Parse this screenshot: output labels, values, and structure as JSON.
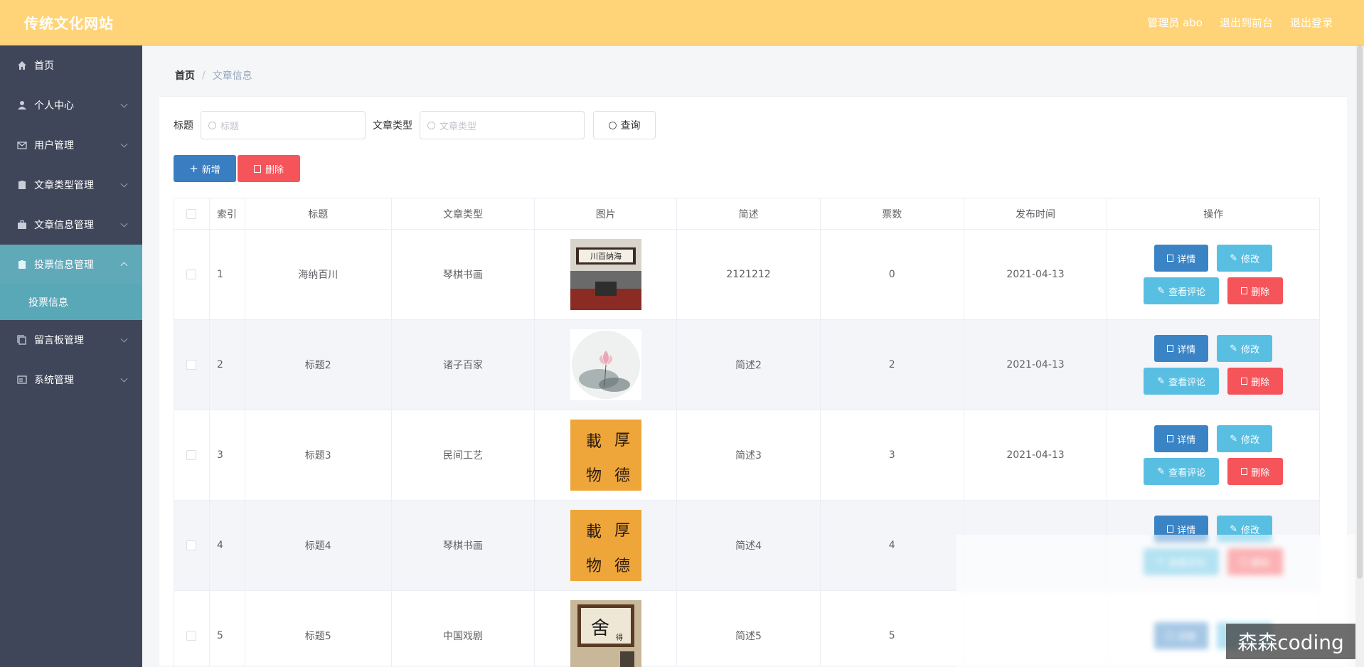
{
  "header": {
    "brand": "传统文化网站",
    "admin": "管理员 abo",
    "to_front": "退出到前台",
    "logout": "退出登录"
  },
  "sidebar": {
    "items": [
      {
        "label": "首页",
        "icon": "home-icon"
      },
      {
        "label": "个人中心",
        "icon": "user-icon"
      },
      {
        "label": "用户管理",
        "icon": "mail-icon"
      },
      {
        "label": "文章类型管理",
        "icon": "delete-box-icon"
      },
      {
        "label": "文章信息管理",
        "icon": "suitcase-icon"
      },
      {
        "label": "投票信息管理",
        "icon": "delete-box-icon"
      },
      {
        "label": "留言板管理",
        "icon": "copy-icon"
      },
      {
        "label": "系统管理",
        "icon": "postcard-icon"
      }
    ],
    "sub_item": "投票信息"
  },
  "breadcrumb": {
    "home": "首页",
    "separator": "/",
    "current": "文章信息"
  },
  "search": {
    "title_label": "标题",
    "title_placeholder": "标题",
    "type_label": "文章类型",
    "type_placeholder": "文章类型",
    "query_button": "查询"
  },
  "actions": {
    "add": "新增",
    "delete": "删除"
  },
  "table": {
    "headers": [
      "索引",
      "标题",
      "文章类型",
      "图片",
      "简述",
      "票数",
      "发布时间",
      "操作"
    ],
    "ops": {
      "detail": "详情",
      "edit": "修改",
      "comments": "查看评论",
      "delete": "删除"
    },
    "rows": [
      {
        "index": "1",
        "title": "海纳百川",
        "type": "琴棋书画",
        "desc": "2121212",
        "votes": "0",
        "date": "2021-04-13"
      },
      {
        "index": "2",
        "title": "标题2",
        "type": "诸子百家",
        "desc": "简述2",
        "votes": "2",
        "date": "2021-04-13"
      },
      {
        "index": "3",
        "title": "标题3",
        "type": "民间工艺",
        "desc": "简述3",
        "votes": "3",
        "date": "2021-04-13"
      },
      {
        "index": "4",
        "title": "标题4",
        "type": "琴棋书画",
        "desc": "简述4",
        "votes": "4",
        "date": ""
      },
      {
        "index": "5",
        "title": "标题5",
        "type": "中国戏剧",
        "desc": "简述5",
        "votes": "5",
        "date": ""
      }
    ]
  },
  "watermark": "森森coding",
  "colors": {
    "header": "#ffd479",
    "sidebar": "#3f4659",
    "active_menu": "#5fa9b8",
    "primary": "#3a84c6",
    "info": "#58bfe2",
    "danger": "#f5545a"
  }
}
